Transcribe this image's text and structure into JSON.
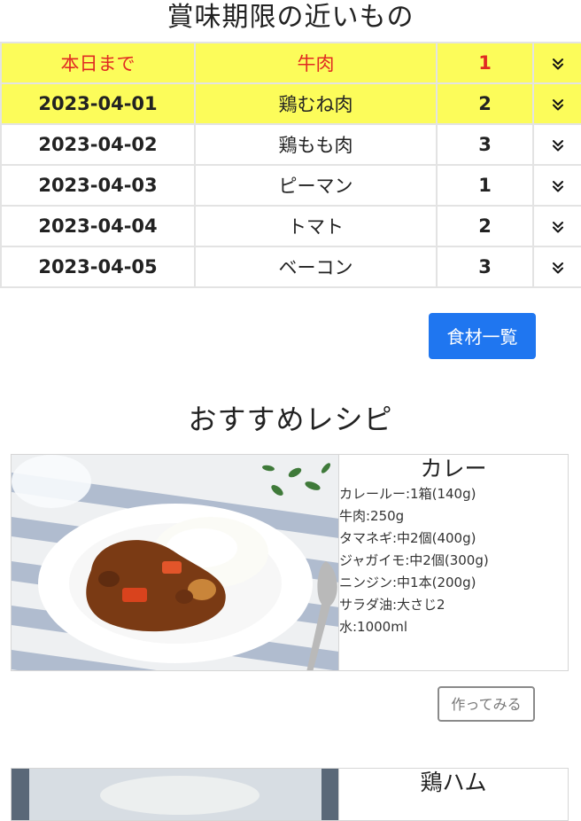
{
  "expiring": {
    "title": "賞味期限の近いもの",
    "rows": [
      {
        "date": "本日まで",
        "name": "牛肉",
        "qty": "1"
      },
      {
        "date": "2023-04-01",
        "name": "鶏むね肉",
        "qty": "2"
      },
      {
        "date": "2023-04-02",
        "name": "鶏もも肉",
        "qty": "3"
      },
      {
        "date": "2023-04-03",
        "name": "ピーマン",
        "qty": "1"
      },
      {
        "date": "2023-04-04",
        "name": "トマト",
        "qty": "2"
      },
      {
        "date": "2023-04-05",
        "name": "ベーコン",
        "qty": "3"
      }
    ],
    "highlight_color": "#fcfc5a",
    "today_text_color": "#e02a22",
    "expand_icon": "double-chevron-down-icon",
    "all_ingredients_button": "食材一覧"
  },
  "recipes": {
    "title": "おすすめレシピ",
    "items": [
      {
        "name": "カレー",
        "ingredients": [
          "カレールー:1箱(140g)",
          "牛肉:250g",
          "タマネギ:中2個(400g)",
          "ジャガイモ:中2個(300g)",
          "ニンジン:中1本(200g)",
          "サラダ油:大さじ2",
          "水:1000ml"
        ],
        "try_button": "作ってみる"
      },
      {
        "name": "鶏ハム",
        "ingredients": []
      }
    ]
  },
  "colors": {
    "primary": "#1f76f0",
    "border": "#e3e3e3"
  }
}
